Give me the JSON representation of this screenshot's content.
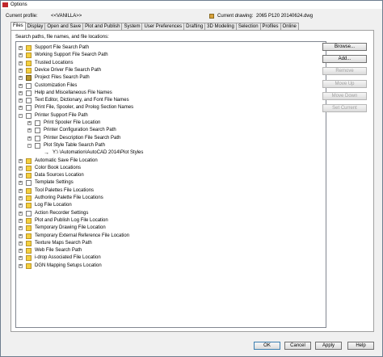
{
  "window": {
    "title": "Options"
  },
  "profile": {
    "label": "Current profile:",
    "value": "<<VANILLA>>",
    "drawing_label": "Current drawing:",
    "drawing_value": "2065 P120 20140624.dwg"
  },
  "tabs": [
    "Files",
    "Display",
    "Open and Save",
    "Plot and Publish",
    "System",
    "User Preferences",
    "Drafting",
    "3D Modeling",
    "Selection",
    "Profiles",
    "Online"
  ],
  "active_tab": "Files",
  "panel": {
    "label": "Search paths, file names, and file locations:"
  },
  "tree": {
    "items": [
      {
        "label": "Support File Search Path",
        "icon": "folder",
        "expander": "+",
        "depth": 0
      },
      {
        "label": "Working Support File Search Path",
        "icon": "folder",
        "expander": "+",
        "depth": 0
      },
      {
        "label": "Trusted Locations",
        "icon": "folder",
        "expander": "+",
        "depth": 0
      },
      {
        "label": "Device Driver File Search Path",
        "icon": "folder",
        "expander": "+",
        "depth": 0
      },
      {
        "label": "Project Files Search Path",
        "icon": "book",
        "expander": "+",
        "depth": 0
      },
      {
        "label": "Customization Files",
        "icon": "doc",
        "expander": "+",
        "depth": 0
      },
      {
        "label": "Help and Miscellaneous File Names",
        "icon": "doc",
        "expander": "+",
        "depth": 0
      },
      {
        "label": "Text Editor, Dictionary, and Font File Names",
        "icon": "doc",
        "expander": "+",
        "depth": 0
      },
      {
        "label": "Print File, Spooler, and Prolog Section Names",
        "icon": "doc",
        "expander": "+",
        "depth": 0
      },
      {
        "label": "Printer Support File Path",
        "icon": "doc",
        "expander": "-",
        "depth": 0
      },
      {
        "label": "Print Spooler File Location",
        "icon": "doc",
        "expander": "+",
        "depth": 1
      },
      {
        "label": "Printer Configuration Search Path",
        "icon": "doc",
        "expander": "+",
        "depth": 1
      },
      {
        "label": "Printer Description File Search Path",
        "icon": "doc",
        "expander": "+",
        "depth": 1
      },
      {
        "label": "Plot Style Table Search Path",
        "icon": "doc",
        "expander": "-",
        "depth": 1
      },
      {
        "label": "Y:\\                 \\Automation\\AutoCAD 2014\\Plot Styles",
        "icon": "arrow",
        "expander": "",
        "depth": 2
      },
      {
        "label": "Automatic Save File Location",
        "icon": "folder",
        "expander": "+",
        "depth": 0
      },
      {
        "label": "Color Book Locations",
        "icon": "folder",
        "expander": "+",
        "depth": 0
      },
      {
        "label": "Data Sources Location",
        "icon": "folder",
        "expander": "+",
        "depth": 0
      },
      {
        "label": "Template Settings",
        "icon": "doc",
        "expander": "+",
        "depth": 0
      },
      {
        "label": "Tool Palettes File Locations",
        "icon": "folder",
        "expander": "+",
        "depth": 0
      },
      {
        "label": "Authoring Palette File Locations",
        "icon": "folder",
        "expander": "+",
        "depth": 0
      },
      {
        "label": "Log File Location",
        "icon": "folder",
        "expander": "+",
        "depth": 0
      },
      {
        "label": "Action Recorder Settings",
        "icon": "doc",
        "expander": "+",
        "depth": 0
      },
      {
        "label": "Plot and Publish Log File Location",
        "icon": "folder",
        "expander": "+",
        "depth": 0
      },
      {
        "label": "Temporary Drawing File Location",
        "icon": "folder",
        "expander": "+",
        "depth": 0
      },
      {
        "label": "Temporary External Reference File Location",
        "icon": "folder",
        "expander": "+",
        "depth": 0
      },
      {
        "label": "Texture Maps Search Path",
        "icon": "folder",
        "expander": "+",
        "depth": 0
      },
      {
        "label": "Web File Search Path",
        "icon": "folder",
        "expander": "+",
        "depth": 0
      },
      {
        "label": "i-drop Associated File Location",
        "icon": "folder",
        "expander": "+",
        "depth": 0
      },
      {
        "label": "DGN Mapping Setups Location",
        "icon": "folder",
        "expander": "+",
        "depth": 0
      }
    ]
  },
  "side_buttons": [
    {
      "label": "Browse...",
      "enabled": true
    },
    {
      "label": "Add...",
      "enabled": true
    },
    {
      "label": "Remove",
      "enabled": false
    },
    {
      "label": "Move Up",
      "enabled": false
    },
    {
      "label": "Move Down",
      "enabled": false
    },
    {
      "label": "Set Current",
      "enabled": false
    }
  ],
  "footer_buttons": [
    "OK",
    "Cancel",
    "Apply",
    "Help"
  ],
  "colors": {
    "folder": "#f4d03f",
    "title_icon": "#c0272d",
    "panel_bg": "#ffffff",
    "dialog_bg": "#f0f0f0"
  }
}
